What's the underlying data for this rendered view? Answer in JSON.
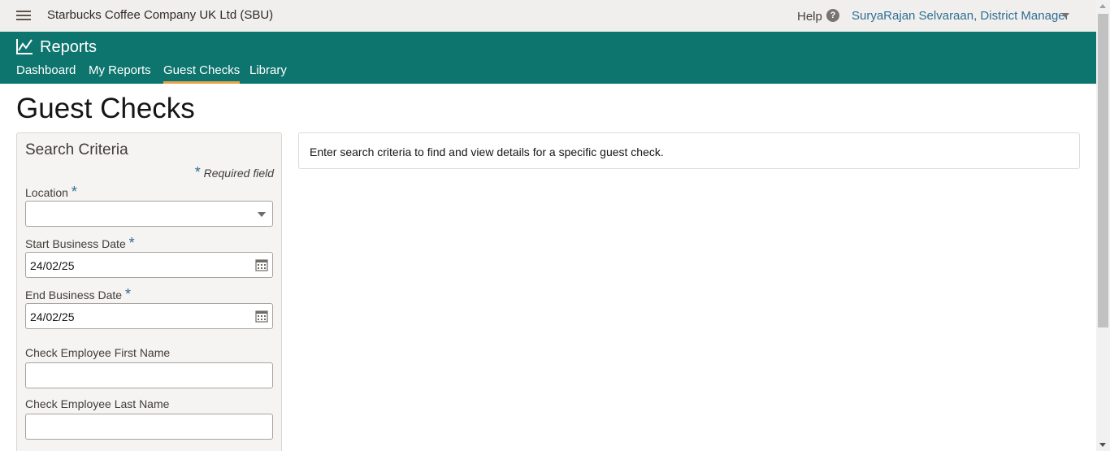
{
  "topbar": {
    "company": "Starbucks Coffee Company UK Ltd (SBU)",
    "help_label": "Help",
    "help_icon": "?",
    "user": "SuryaRajan Selvaraan, District Manager"
  },
  "appbar": {
    "title": "Reports",
    "tabs": [
      {
        "label": "Dashboard"
      },
      {
        "label": "My Reports"
      },
      {
        "label": "Guest Checks",
        "active": true
      },
      {
        "label": "Library"
      }
    ],
    "color": "#0d756e",
    "active_tab_color": "#e8a34a"
  },
  "page": {
    "title": "Guest Checks"
  },
  "search": {
    "title": "Search Criteria",
    "required_star": "*",
    "required_note": "Required field",
    "location_label": "Location",
    "location_value": "",
    "start_date_label": "Start Business Date",
    "start_date_value": "24/02/25",
    "end_date_label": "End Business Date",
    "end_date_value": "24/02/25",
    "emp_first_label": "Check Employee First Name",
    "emp_first_value": "",
    "emp_last_label": "Check Employee Last Name",
    "emp_last_value": ""
  },
  "info": {
    "text": "Enter search criteria to find and view details for a specific guest check."
  }
}
